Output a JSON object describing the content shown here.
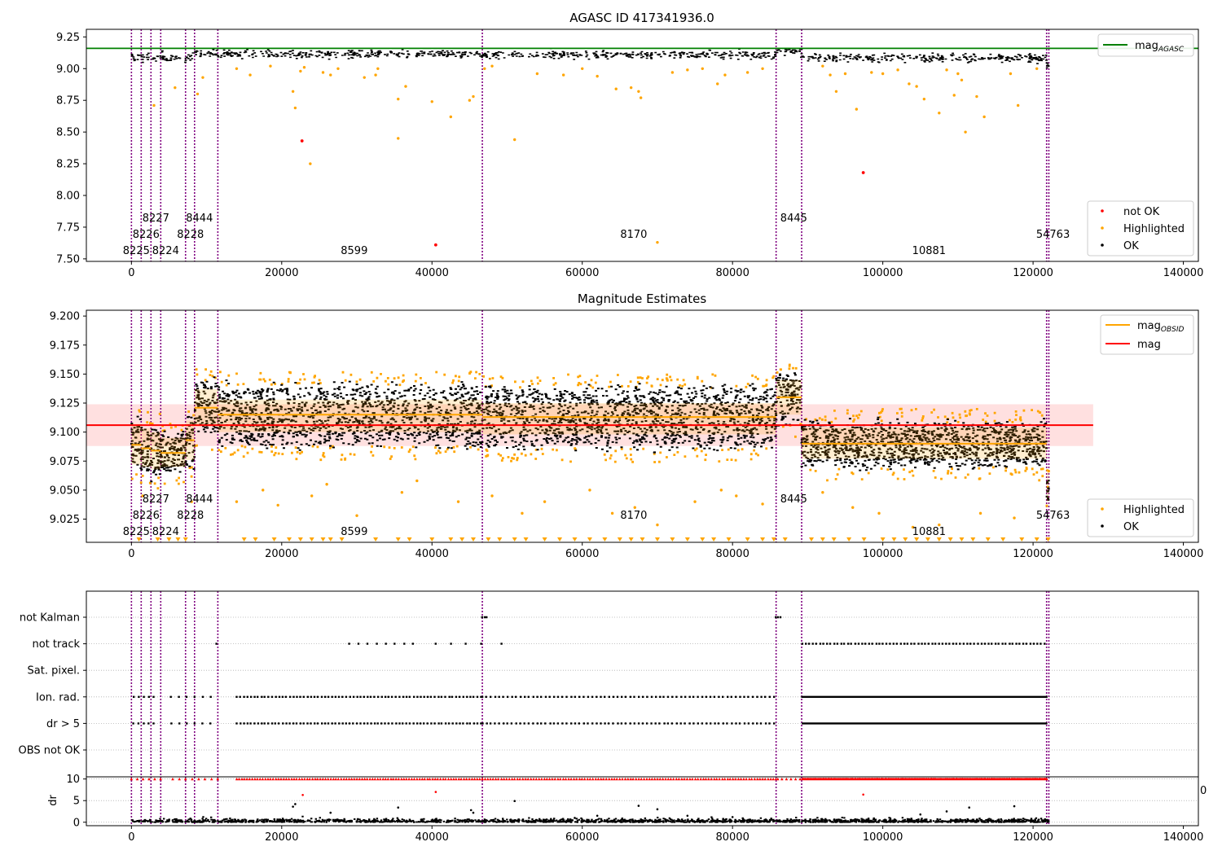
{
  "chart_data": [
    {
      "type": "scatter",
      "title": "AGASC ID 417341936.0",
      "xlabel": "",
      "ylabel": "",
      "xlim": [
        -6000,
        142000
      ],
      "ylim": [
        7.48,
        9.31
      ],
      "xticks": [
        0,
        20000,
        40000,
        60000,
        80000,
        100000,
        120000,
        140000
      ],
      "yticks": [
        7.5,
        7.75,
        8.0,
        8.25,
        8.5,
        8.75,
        9.0,
        9.25
      ],
      "ytick_labels": [
        "7.50",
        "7.75",
        "8.00",
        "8.25",
        "8.50",
        "8.75",
        "9.00",
        "9.25"
      ],
      "hline": {
        "y": 9.16,
        "color": "#008000"
      },
      "obs_boundaries": [
        0,
        1300,
        2600,
        3900,
        7200,
        8400,
        11500,
        46700,
        85800,
        89200,
        121800,
        122100
      ],
      "obs_labels": [
        {
          "x": 0,
          "row": 0,
          "text": "8225"
        },
        {
          "x": 1300,
          "row": 1,
          "text": "8226"
        },
        {
          "x": 2600,
          "row": 2,
          "text": "8227"
        },
        {
          "x": 3900,
          "row": 0,
          "text": "8224"
        },
        {
          "x": 7200,
          "row": 1,
          "text": "8228"
        },
        {
          "x": 8400,
          "row": 2,
          "text": "8444"
        },
        {
          "x": 29000,
          "row": 0,
          "text": "8599"
        },
        {
          "x": 66200,
          "row": 1,
          "text": "8170"
        },
        {
          "x": 87500,
          "row": 2,
          "text": "8445"
        },
        {
          "x": 105500,
          "row": 0,
          "text": "10881"
        },
        {
          "x": 122000,
          "row": 1,
          "text": "54763"
        }
      ],
      "segments": [
        {
          "x0": 0,
          "x1": 1300,
          "level": 9.098
        },
        {
          "x0": 1300,
          "x1": 2600,
          "level": 9.095
        },
        {
          "x0": 2600,
          "x1": 3900,
          "level": 9.092
        },
        {
          "x0": 3900,
          "x1": 7200,
          "level": 9.088
        },
        {
          "x0": 7200,
          "x1": 8400,
          "level": 9.1
        },
        {
          "x0": 8400,
          "x1": 11500,
          "level": 9.125
        },
        {
          "x0": 11500,
          "x1": 46700,
          "level": 9.12
        },
        {
          "x0": 46700,
          "x1": 85800,
          "level": 9.115
        },
        {
          "x0": 85800,
          "x1": 89200,
          "level": 9.14
        },
        {
          "x0": 89200,
          "x1": 121800,
          "level": 9.09
        },
        {
          "x0": 121800,
          "x1": 122100,
          "level": 9.05
        }
      ],
      "band_halfwidth": 0.02,
      "highlighted": [
        [
          3000,
          8.71
        ],
        [
          5800,
          8.85
        ],
        [
          8800,
          8.8
        ],
        [
          9500,
          8.93
        ],
        [
          14000,
          9.0
        ],
        [
          15800,
          8.95
        ],
        [
          18500,
          9.02
        ],
        [
          21500,
          8.82
        ],
        [
          21800,
          8.69
        ],
        [
          22500,
          8.98
        ],
        [
          23000,
          9.01
        ],
        [
          23800,
          8.25
        ],
        [
          25500,
          8.97
        ],
        [
          26500,
          8.95
        ],
        [
          27500,
          9.0
        ],
        [
          31000,
          8.93
        ],
        [
          32500,
          8.95
        ],
        [
          32800,
          9.0
        ],
        [
          35500,
          8.76
        ],
        [
          35500,
          8.45
        ],
        [
          36500,
          8.86
        ],
        [
          40000,
          8.74
        ],
        [
          42500,
          8.62
        ],
        [
          45000,
          8.75
        ],
        [
          45500,
          8.78
        ],
        [
          47000,
          9.0
        ],
        [
          48000,
          9.02
        ],
        [
          51000,
          8.44
        ],
        [
          54000,
          8.96
        ],
        [
          57500,
          8.95
        ],
        [
          60000,
          9.0
        ],
        [
          62000,
          8.94
        ],
        [
          64500,
          8.84
        ],
        [
          66500,
          8.85
        ],
        [
          67500,
          8.82
        ],
        [
          67800,
          8.77
        ],
        [
          70000,
          7.63
        ],
        [
          72000,
          8.97
        ],
        [
          74000,
          8.99
        ],
        [
          76000,
          9.0
        ],
        [
          78000,
          8.88
        ],
        [
          79000,
          8.95
        ],
        [
          82000,
          8.97
        ],
        [
          84000,
          9.0
        ],
        [
          92000,
          9.02
        ],
        [
          93000,
          8.95
        ],
        [
          93800,
          8.82
        ],
        [
          95000,
          8.96
        ],
        [
          96500,
          8.68
        ],
        [
          98500,
          8.97
        ],
        [
          100000,
          8.96
        ],
        [
          102000,
          8.99
        ],
        [
          103500,
          8.88
        ],
        [
          104500,
          8.86
        ],
        [
          105500,
          8.76
        ],
        [
          107500,
          8.65
        ],
        [
          108500,
          8.99
        ],
        [
          109500,
          8.79
        ],
        [
          110000,
          8.96
        ],
        [
          110500,
          8.91
        ],
        [
          111000,
          8.5
        ],
        [
          112500,
          8.78
        ],
        [
          113500,
          8.62
        ],
        [
          117000,
          8.96
        ],
        [
          118000,
          8.71
        ],
        [
          120500,
          9.0
        ]
      ],
      "not_ok": [
        [
          22700,
          8.43
        ],
        [
          40500,
          7.61
        ],
        [
          97400,
          8.18
        ]
      ],
      "legend_main": {
        "position": "top-right",
        "entries": [
          {
            "label": "mag",
            "sub": "AGASC",
            "color": "#008000"
          }
        ]
      },
      "legend_points": {
        "position": "bottom-right",
        "entries": [
          {
            "label": "not OK",
            "color": "#ff0000"
          },
          {
            "label": "Highlighted",
            "color": "#ffa500"
          },
          {
            "label": "OK",
            "color": "#000000"
          }
        ]
      }
    },
    {
      "type": "scatter",
      "title": "Magnitude Estimates",
      "xlabel": "",
      "ylabel": "",
      "xlim": [
        -6000,
        142000
      ],
      "ylim": [
        9.005,
        9.205
      ],
      "xticks": [
        0,
        20000,
        40000,
        60000,
        80000,
        100000,
        120000,
        140000
      ],
      "yticks": [
        9.025,
        9.05,
        9.075,
        9.1,
        9.125,
        9.15,
        9.175,
        9.2
      ],
      "ytick_labels": [
        "9.025",
        "9.050",
        "9.075",
        "9.100",
        "9.125",
        "9.150",
        "9.175",
        "9.200"
      ],
      "mag": {
        "value": 9.106,
        "stdev": 0.018,
        "x0": -6000,
        "x1": 128000,
        "color": "#ff0000"
      },
      "obs_segments": [
        {
          "x0": 0,
          "x1": 1300,
          "mean": 9.089,
          "lo": 9.072,
          "hi": 9.107,
          "spread": 0.02
        },
        {
          "x0": 1300,
          "x1": 2600,
          "mean": 9.086,
          "lo": 9.07,
          "hi": 9.103,
          "spread": 0.02
        },
        {
          "x0": 2600,
          "x1": 3900,
          "mean": 9.084,
          "lo": 9.068,
          "hi": 9.1,
          "spread": 0.02
        },
        {
          "x0": 3900,
          "x1": 7200,
          "mean": 9.082,
          "lo": 9.07,
          "hi": 9.095,
          "spread": 0.015
        },
        {
          "x0": 7200,
          "x1": 8400,
          "mean": 9.093,
          "lo": 9.076,
          "hi": 9.11,
          "spread": 0.02
        },
        {
          "x0": 8400,
          "x1": 11500,
          "mean": 9.121,
          "lo": 9.105,
          "hi": 9.137,
          "spread": 0.022
        },
        {
          "x0": 11500,
          "x1": 46700,
          "mean": 9.115,
          "lo": 9.1,
          "hi": 9.128,
          "spread": 0.024
        },
        {
          "x0": 46700,
          "x1": 85800,
          "mean": 9.113,
          "lo": 9.098,
          "hi": 9.125,
          "spread": 0.024
        },
        {
          "x0": 85800,
          "x1": 89200,
          "mean": 9.13,
          "lo": 9.115,
          "hi": 9.145,
          "spread": 0.02
        },
        {
          "x0": 89200,
          "x1": 121800,
          "mean": 9.09,
          "lo": 9.077,
          "hi": 9.104,
          "spread": 0.017
        },
        {
          "x0": 121800,
          "x1": 122100,
          "mean": 9.053,
          "lo": 9.04,
          "hi": 9.066,
          "spread": 0.01
        }
      ],
      "highlighted_low_markers": [
        1000,
        3500,
        5000,
        6200,
        7200,
        15000,
        16500,
        19000,
        21000,
        22500,
        24000,
        25500,
        26500,
        28000,
        32500,
        35500,
        37000,
        40000,
        42500,
        44000,
        45500,
        47500,
        49000,
        51000,
        52500,
        55000,
        57000,
        59000,
        61000,
        63000,
        65000,
        66500,
        68000,
        70000,
        72000,
        74000,
        76000,
        77500,
        79500,
        82000,
        84000,
        85500,
        87000,
        90500,
        92000,
        93500,
        95500,
        97500,
        100000,
        101500,
        103000,
        104500,
        106000,
        107500,
        109000,
        110500,
        112000,
        114000,
        116000,
        118500,
        120500,
        122000
      ],
      "highlighted_outliers": [
        [
          1500,
          9.045
        ],
        [
          8000,
          9.04
        ],
        [
          14000,
          9.04
        ],
        [
          17500,
          9.05
        ],
        [
          19500,
          9.037
        ],
        [
          24000,
          9.045
        ],
        [
          26000,
          9.055
        ],
        [
          30000,
          9.028
        ],
        [
          36000,
          9.048
        ],
        [
          38000,
          9.058
        ],
        [
          43500,
          9.04
        ],
        [
          48000,
          9.045
        ],
        [
          52000,
          9.03
        ],
        [
          55000,
          9.04
        ],
        [
          61000,
          9.05
        ],
        [
          64000,
          9.03
        ],
        [
          67000,
          9.035
        ],
        [
          70000,
          9.02
        ],
        [
          75000,
          9.04
        ],
        [
          78500,
          9.05
        ],
        [
          80500,
          9.045
        ],
        [
          84000,
          9.038
        ],
        [
          92000,
          9.048
        ],
        [
          96000,
          9.035
        ],
        [
          99500,
          9.03
        ],
        [
          104000,
          9.018
        ],
        [
          107500,
          9.02
        ],
        [
          113000,
          9.03
        ],
        [
          117500,
          9.026
        ]
      ],
      "obs_labels": [
        {
          "x": 0,
          "row": 0,
          "text": "8225"
        },
        {
          "x": 1300,
          "row": 1,
          "text": "8226"
        },
        {
          "x": 2600,
          "row": 2,
          "text": "8227"
        },
        {
          "x": 3900,
          "row": 0,
          "text": "8224"
        },
        {
          "x": 7200,
          "row": 1,
          "text": "8228"
        },
        {
          "x": 8400,
          "row": 2,
          "text": "8444"
        },
        {
          "x": 29000,
          "row": 0,
          "text": "8599"
        },
        {
          "x": 66200,
          "row": 1,
          "text": "8170"
        },
        {
          "x": 87500,
          "row": 2,
          "text": "8445"
        },
        {
          "x": 105500,
          "row": 0,
          "text": "10881"
        },
        {
          "x": 122000,
          "row": 1,
          "text": "54763"
        }
      ],
      "legend_lines": {
        "position": "top-right",
        "entries": [
          {
            "label": "mag",
            "sub": "OBSID",
            "color": "#ffa500"
          },
          {
            "label": "mag",
            "sub": "",
            "color": "#ff0000"
          }
        ]
      },
      "legend_points": {
        "position": "bottom-right",
        "entries": [
          {
            "label": "Highlighted",
            "color": "#ffa500"
          },
          {
            "label": "OK",
            "color": "#000000"
          }
        ]
      }
    },
    {
      "type": "scatter",
      "title": "",
      "xlabel": "",
      "ylabel": "",
      "xlim": [
        -6000,
        142000
      ],
      "xticks": [
        0,
        20000,
        40000,
        60000,
        80000,
        100000,
        120000,
        140000
      ],
      "flag_rows": [
        "not Kalman",
        "not track",
        "Sat. pixel.",
        "Ion. rad.",
        "dr > 5",
        "OBS not OK"
      ],
      "flag_spans": {
        "not Kalman": [
          [
            46700,
            47300,
            3
          ],
          [
            85800,
            86400,
            3
          ]
        ],
        "not track": [
          [
            11200,
            11400,
            1
          ],
          [
            29000,
            37500,
            8
          ],
          [
            40500,
            46500,
            4
          ],
          [
            49000,
            49500,
            1
          ],
          [
            89300,
            121500,
            70
          ]
        ],
        "Sat. pixel.": [],
        "Ion. rad.": [
          [
            300,
            3000,
            5
          ],
          [
            5300,
            10500,
            6
          ],
          [
            14000,
            46500,
            70
          ],
          [
            46700,
            85500,
            70
          ],
          [
            89300,
            121800,
            230
          ]
        ],
        "dr > 5": [
          [
            300,
            3000,
            5
          ],
          [
            5300,
            10500,
            6
          ],
          [
            14000,
            46500,
            70
          ],
          [
            46700,
            85500,
            70
          ],
          [
            89300,
            121800,
            230
          ]
        ],
        "OBS not OK": []
      },
      "dr_ylabel": "dr",
      "dr_yticks": [
        0,
        5,
        10
      ],
      "dr_ylim": [
        -0.8,
        10.5
      ],
      "dr_clip_value": 10,
      "dr_clipped_spans": [
        [
          0,
          3900,
          6
        ],
        [
          5500,
          11500,
          8
        ],
        [
          14000,
          46700,
          95
        ],
        [
          46700,
          85800,
          110
        ],
        [
          86000,
          89000,
          6
        ],
        [
          89300,
          121800,
          310
        ]
      ],
      "dr_outliers": [
        [
          21500,
          3.6
        ],
        [
          21800,
          4.2
        ],
        [
          22800,
          6.3
        ],
        [
          26500,
          2.2
        ],
        [
          35500,
          3.4
        ],
        [
          40500,
          7.0
        ],
        [
          45200,
          2.8
        ],
        [
          45500,
          2.2
        ],
        [
          51000,
          4.9
        ],
        [
          59000,
          1.0
        ],
        [
          62000,
          1.5
        ],
        [
          67500,
          3.8
        ],
        [
          70000,
          3.0
        ],
        [
          74000,
          1.5
        ],
        [
          80000,
          1.2
        ],
        [
          97400,
          6.4
        ],
        [
          105000,
          1.8
        ],
        [
          108500,
          2.5
        ],
        [
          111500,
          3.4
        ],
        [
          117500,
          3.7
        ]
      ],
      "ok_band_spans": [
        [
          0,
          46700,
          160
        ],
        [
          46700,
          89000,
          180
        ],
        [
          89200,
          122100,
          150
        ]
      ],
      "obs_boundaries": [
        0,
        1300,
        2600,
        3900,
        7200,
        8400,
        11500,
        46700,
        85800,
        89200,
        121800,
        122100
      ],
      "stray_tick_text": "0"
    }
  ]
}
